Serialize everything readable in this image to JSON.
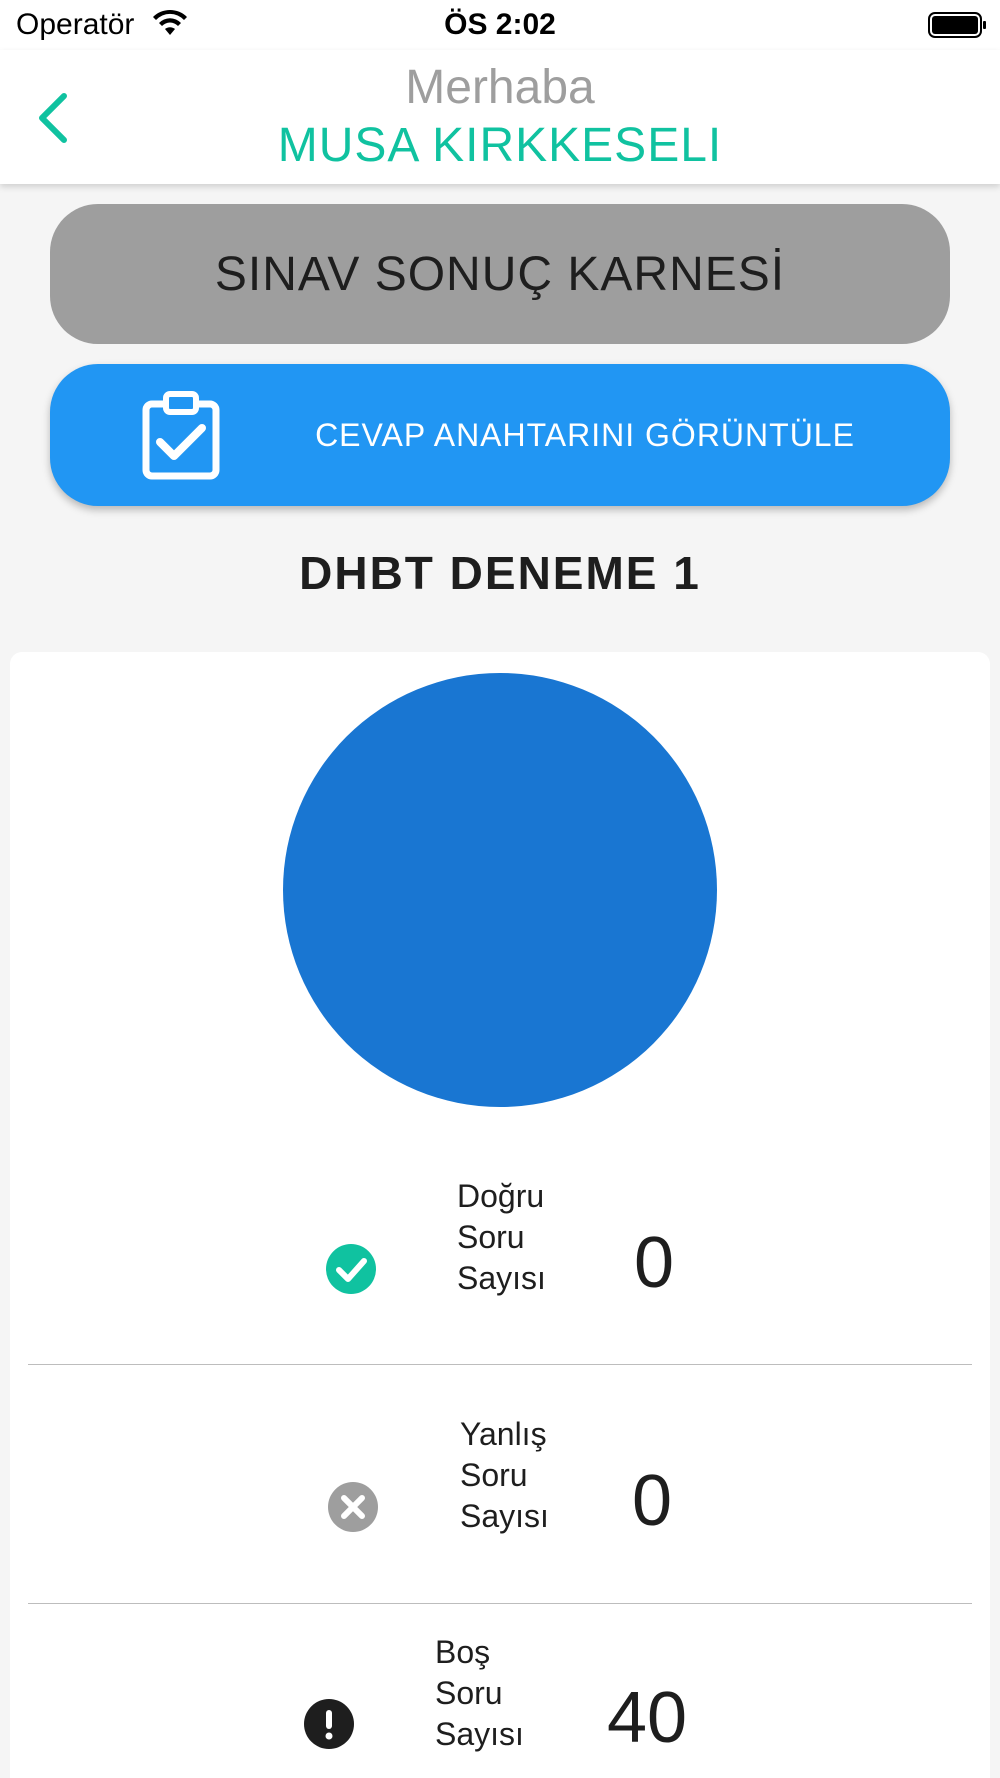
{
  "status_bar": {
    "carrier": "Operatör",
    "time": "ÖS 2:02",
    "wifi_icon": "wifi-icon",
    "battery_icon": "battery-icon"
  },
  "header": {
    "back_icon": "chevron-left-icon",
    "greeting": "Merhaba",
    "user_name": "MUSA KIRKKESELI"
  },
  "buttons": {
    "report_label": "SINAV SONUÇ KARNESİ",
    "answer_key_label": "CEVAP ANAHTARINI GÖRÜNTÜLE",
    "answer_key_icon": "clipboard-check-icon"
  },
  "exam": {
    "title": "DHBT DENEME 1"
  },
  "chart_data": {
    "type": "pie",
    "categories": [
      "Doğru",
      "Yanlış",
      "Boş"
    ],
    "values": [
      0,
      0,
      40
    ],
    "colors": [
      "#10c2a0",
      "#9e9e9e",
      "#1976d2"
    ]
  },
  "stats": [
    {
      "label_lines": [
        "Doğru",
        "Soru",
        "Sayısı"
      ],
      "value": "0",
      "icon": "check-circle-icon",
      "color": "#10c2a0"
    },
    {
      "label_lines": [
        "Yanlış",
        "Soru",
        "Sayısı"
      ],
      "value": "0",
      "icon": "x-circle-icon",
      "color": "#9e9e9e"
    },
    {
      "label_lines": [
        "Boş",
        "Soru",
        "Sayısı"
      ],
      "value": "40",
      "icon": "exclamation-circle-icon",
      "color": "#1e1e1e"
    }
  ],
  "theme": {
    "accent": "#10c2a0",
    "primary_button": "#2196f3",
    "secondary_button": "#9e9e9e"
  }
}
